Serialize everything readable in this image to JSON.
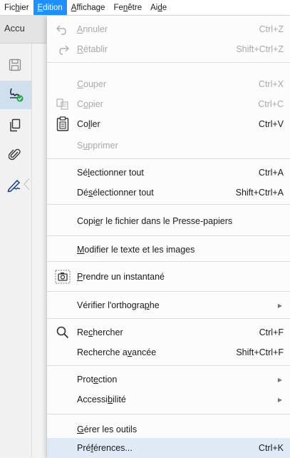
{
  "menubar": {
    "items": [
      {
        "pre": "Fic",
        "ul": "h",
        "post": "ier"
      },
      {
        "pre": "",
        "ul": "E",
        "post": "dition"
      },
      {
        "pre": "",
        "ul": "A",
        "post": "ffichage"
      },
      {
        "pre": "Fe",
        "ul": "n",
        "post": "être"
      },
      {
        "pre": "Ai",
        "ul": "d",
        "post": "e"
      }
    ]
  },
  "app": {
    "tab_label": "Accu"
  },
  "sidebar": {
    "icons": [
      "save-icon",
      "sign-icon",
      "pages-icon",
      "attachment-icon",
      "fill-sign-icon"
    ]
  },
  "menu": {
    "items": [
      {
        "pre": "",
        "ul": "A",
        "post": "nnuler",
        "shortcut": "Ctrl+Z",
        "disabled": true,
        "icon": "undo-icon"
      },
      {
        "pre": "",
        "ul": "R",
        "post": "établir",
        "shortcut": "Shift+Ctrl+Z",
        "disabled": true,
        "icon": "redo-icon"
      },
      {
        "pre": "",
        "ul": "C",
        "post": "ouper",
        "shortcut": "Ctrl+X",
        "disabled": true
      },
      {
        "pre": "C",
        "ul": "o",
        "post": "pier",
        "shortcut": "Ctrl+C",
        "disabled": true,
        "icon": "copy-icon"
      },
      {
        "pre": "Co",
        "ul": "l",
        "post": "ler",
        "shortcut": "Ctrl+V",
        "disabled": false,
        "icon": "paste-icon"
      },
      {
        "pre": "S",
        "ul": "u",
        "post": "pprimer",
        "shortcut": "",
        "disabled": true
      },
      {
        "pre": "Sé",
        "ul": "l",
        "post": "ectionner tout",
        "shortcut": "Ctrl+A",
        "disabled": false
      },
      {
        "pre": "Dé",
        "ul": "s",
        "post": "électionner tout",
        "shortcut": "Shift+Ctrl+A",
        "disabled": false
      },
      {
        "pre": "Copi",
        "ul": "e",
        "post": "r le fichier dans le Presse-papiers",
        "shortcut": "",
        "disabled": false
      },
      {
        "pre": "",
        "ul": "M",
        "post": "odifier le texte et les images",
        "shortcut": "",
        "disabled": false
      },
      {
        "pre": "",
        "ul": "P",
        "post": "rendre un instantané",
        "shortcut": "",
        "disabled": false,
        "icon": "camera-icon"
      },
      {
        "pre": "Vérifier l'orthogra",
        "ul": "p",
        "post": "he",
        "shortcut": "",
        "disabled": false,
        "submenu": true
      },
      {
        "pre": "Re",
        "ul": "c",
        "post": "hercher",
        "shortcut": "Ctrl+F",
        "disabled": false,
        "icon": "search-icon"
      },
      {
        "pre": "Recherche a",
        "ul": "v",
        "post": "ancée",
        "shortcut": "Shift+Ctrl+F",
        "disabled": false
      },
      {
        "pre": "Prot",
        "ul": "e",
        "post": "ction",
        "shortcut": "",
        "disabled": false,
        "submenu": true
      },
      {
        "pre": "Accessi",
        "ul": "b",
        "post": "ilité",
        "shortcut": "",
        "disabled": false,
        "submenu": true
      },
      {
        "pre": "",
        "ul": "G",
        "post": "érer les outils",
        "shortcut": "",
        "disabled": false
      },
      {
        "pre": "Pré",
        "ul": "f",
        "post": "érences...",
        "shortcut": "Ctrl+K",
        "disabled": false,
        "highlight": true
      }
    ]
  }
}
